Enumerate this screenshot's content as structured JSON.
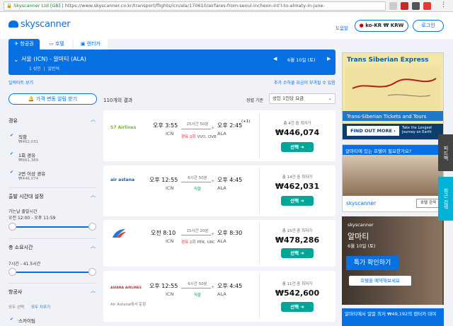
{
  "browser": {
    "site_label": "Skyscanner Ltd [GB]",
    "url": "https://www.skyscanner.co.kr/transport/flights/icn/ala/170610/airfares-from-seoul-incheon-int'l-to-almaty-in-june-"
  },
  "header": {
    "logo_text": "skyscanner",
    "help": "도움말",
    "locale": "ko-KR ₩ KRW",
    "login": "로그인"
  },
  "tabs": [
    {
      "label": "항공권"
    },
    {
      "label": "호텔"
    },
    {
      "label": "렌터카"
    }
  ],
  "search": {
    "route": "서울 (ICN) - 알마티 (ALA)",
    "adults": "1 성인",
    "cabin": "일반석",
    "date": "6월 10일 (토)"
  },
  "links": {
    "compare_month": "일럭마트 보기",
    "fees": "추가 수하물 요금이 부과될 수 있음"
  },
  "alert_button": "가격 변동 알림 받기",
  "result_count": "110개의 결과",
  "sort": {
    "label": "정렬 기준",
    "value": "성인 1인당 요금"
  },
  "filters": {
    "stops": {
      "title": "경유",
      "options": [
        {
          "label": "직항",
          "price": "₩462,031"
        },
        {
          "label": "1회 경유",
          "price": "₩661,389"
        },
        {
          "label": "2번 이상 경유",
          "price": "₩446,074"
        }
      ]
    },
    "departure": {
      "title": "출발 시간대 설정",
      "sub": "가는날 출발시간",
      "range": "오전 12:00 - 오후 11:59"
    },
    "duration": {
      "title": "총 소요시간",
      "range": "7시간 - 41.5시간"
    },
    "airlines": {
      "title": "항공사",
      "select_all": "모두 선택",
      "clear_all": "모두 지우기",
      "first": "스카이팀"
    }
  },
  "results": [
    {
      "airline": "S7 Airlines",
      "depart_time": "오후 3:55",
      "depart_code": "ICN",
      "duration": "25시간 50분",
      "stops": "경유 2회",
      "via": "VVO, OVB",
      "arrive_time": "오후 2:45",
      "arrive_plus": "(+1)",
      "arrive_code": "ALA",
      "deals": "총 4건 중 최저가",
      "price": "₩446,074",
      "select": "선택 ➜"
    },
    {
      "airline": "air astana",
      "depart_time": "오후 12:55",
      "depart_code": "ICN",
      "duration": "6시간 50분",
      "stops": "직항",
      "via": "",
      "arrive_time": "오후 4:45",
      "arrive_plus": "",
      "arrive_code": "ALA",
      "deals": "총 14건 중 최저가",
      "price": "₩462,031",
      "select": "선택 ➜"
    },
    {
      "airline": "China Southern",
      "depart_time": "오전 8:10",
      "depart_code": "ICN",
      "duration": "15시간 20분",
      "stops": "경유 2회",
      "via": "PEK, URC",
      "arrive_time": "오후 8:30",
      "arrive_plus": "",
      "arrive_code": "ALA",
      "deals": "총 15건 중 최저가",
      "price": "₩478,286",
      "select": "선택 ➜"
    },
    {
      "airline": "ASIANA AIRLINES",
      "depart_time": "오후 12:55",
      "depart_code": "ICN",
      "duration": "6시간 50분",
      "stops": "직항",
      "via": "",
      "arrive_time": "오후 4:45",
      "arrive_plus": "",
      "arrive_code": "ALA",
      "operated": "Air Astana에서 운항",
      "deals": "총 11건 중 최저가",
      "price": "₩542,600",
      "select": "선택 ➜"
    }
  ],
  "ads": {
    "trans_siberian": {
      "title": "Trans Siberian Express",
      "subtitle": "Trans-Siberian Tickets and Tours",
      "cta": "FIND OUT MORE ›",
      "tagline": "Take the Longest Journey on Earth"
    },
    "hotel": {
      "title": "알마티에 있는 호텔이 필요한가요?",
      "logo": "skyscanner",
      "cta": "호텔 검색"
    },
    "promo": {
      "logo": "skyscanner",
      "city": "알마티",
      "date": "6월 10일 (토)",
      "headline": "특가 확인하기",
      "cta": "호텔을 예약해보세요"
    },
    "bottom": {
      "text": "알마티에서 얼말 최저 ₩49,192의 렌터카 대여"
    },
    "side_tab_1": "피드백",
    "side_tab_2": "최근 검색"
  },
  "colors": {
    "brand": "#0770e3",
    "select_button": "#00a698",
    "stop_red": "#e02020"
  }
}
